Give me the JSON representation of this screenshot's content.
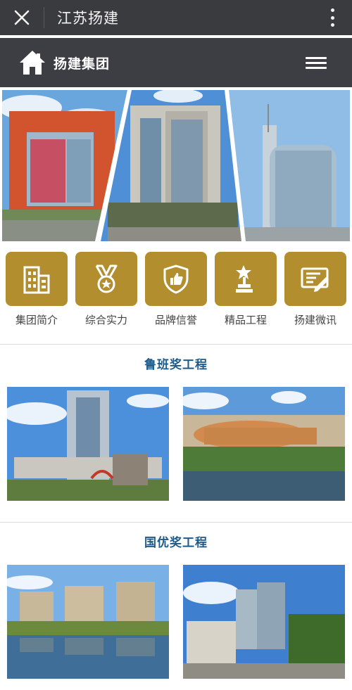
{
  "app": {
    "title": "江苏扬建"
  },
  "header": {
    "brand": "扬建集团"
  },
  "quicknav": [
    {
      "label": "集团简介",
      "icon": "buildings-icon"
    },
    {
      "label": "综合实力",
      "icon": "medal-icon"
    },
    {
      "label": "品牌信誉",
      "icon": "shield-thumbs-up-icon"
    },
    {
      "label": "精品工程",
      "icon": "trophy-icon"
    },
    {
      "label": "扬建微讯",
      "icon": "news-pen-icon"
    }
  ],
  "sections": [
    {
      "title": "鲁班奖工程"
    },
    {
      "title": "国优奖工程"
    }
  ],
  "colors": {
    "accent": "#b28e2e",
    "section_title": "#1e5a8a",
    "topbar": "#3a3b3f",
    "header": "#3d3e43"
  }
}
